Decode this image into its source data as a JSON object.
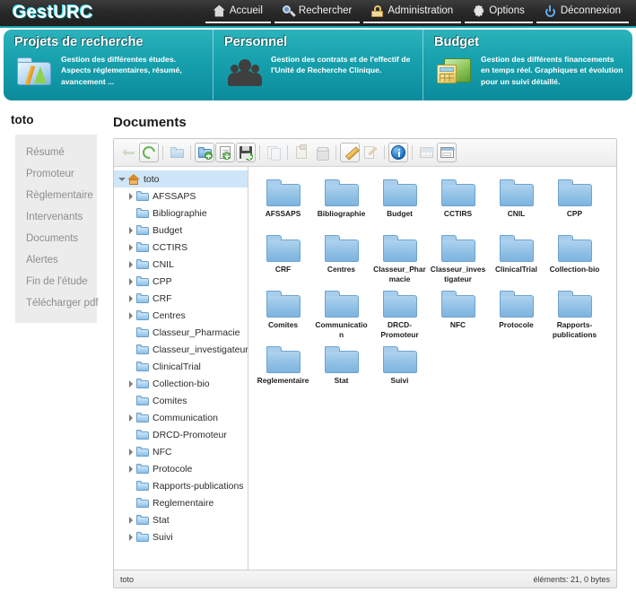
{
  "app": {
    "logo": "GestURC"
  },
  "mainnav": [
    {
      "label": "Accueil",
      "icon": "home-icon"
    },
    {
      "label": "Rechercher",
      "icon": "search-icon"
    },
    {
      "label": "Administration",
      "icon": "lock-icon"
    },
    {
      "label": "Options",
      "icon": "gear-icon"
    },
    {
      "label": "Déconnexion",
      "icon": "power-icon"
    }
  ],
  "banner": {
    "cards": [
      {
        "title": "Projets de recherche",
        "desc": "Gestion des différentes études. Aspects réglementaires, résumé, avancement ...",
        "icon": "folder-ruler-icon"
      },
      {
        "title": "Personnel",
        "desc": "Gestion des contrats et de l'effectif de l'Unité de Recherche Clinique.",
        "icon": "people-icon"
      },
      {
        "title": "Budget",
        "desc": "Gestion des différents financements en temps réel. Graphiques et évolution pour un suivi détaillé.",
        "icon": "calculator-folder-icon"
      }
    ]
  },
  "sidebar": {
    "study_title": "toto",
    "items": [
      {
        "label": "Résumé"
      },
      {
        "label": "Promoteur"
      },
      {
        "label": "Règlementaire"
      },
      {
        "label": "Intervenants"
      },
      {
        "label": "Documents"
      },
      {
        "label": "Alertes"
      },
      {
        "label": "Fin de l'étude"
      },
      {
        "label": "Télécharger pdf"
      }
    ]
  },
  "main": {
    "title": "Documents"
  },
  "toolbar": {
    "buttons": [
      {
        "name": "back-button",
        "icon": "back-arrow-icon",
        "glyph": "g-arrow",
        "state": "dim",
        "framed": false,
        "badge": false
      },
      {
        "name": "refresh-button",
        "icon": "refresh-icon",
        "glyph": "g-refresh",
        "state": "normal",
        "framed": true,
        "badge": false
      },
      {
        "sep": true
      },
      {
        "name": "folder-button",
        "icon": "folder-icon",
        "glyph": "g-fold",
        "state": "dim",
        "framed": false,
        "badge": false
      },
      {
        "sep": true
      },
      {
        "name": "new-folder-button",
        "icon": "folder-add-icon",
        "glyph": "g-fold",
        "state": "normal",
        "framed": true,
        "badge": true
      },
      {
        "name": "new-file-button",
        "icon": "file-add-icon",
        "glyph": "g-page",
        "state": "normal",
        "framed": true,
        "badge": true
      },
      {
        "name": "save-button",
        "icon": "floppy-add-icon",
        "glyph": "g-disk",
        "state": "normal",
        "framed": true,
        "badge": true
      },
      {
        "sep": true
      },
      {
        "name": "copy-button",
        "icon": "copy-icon",
        "glyph": "g-copy",
        "state": "dim",
        "framed": false,
        "badge": false
      },
      {
        "sep": true
      },
      {
        "name": "paste-button",
        "icon": "clipboard-icon",
        "glyph": "g-clip",
        "state": "dim",
        "framed": false,
        "badge": false
      },
      {
        "name": "delete-button",
        "icon": "trash-icon",
        "glyph": "g-bin",
        "state": "dim",
        "framed": false,
        "badge": false
      },
      {
        "sep": true
      },
      {
        "name": "rename-button",
        "icon": "pencil-icon",
        "glyph": "g-pencil",
        "state": "normal",
        "framed": true,
        "badge": false
      },
      {
        "name": "edit-button",
        "icon": "edit-document-icon",
        "glyph": "g-edit",
        "state": "dim",
        "framed": false,
        "badge": false
      },
      {
        "sep": true
      },
      {
        "name": "info-button",
        "icon": "info-icon",
        "glyph": "g-info",
        "state": "normal",
        "framed": true,
        "badge": false
      },
      {
        "sep": true
      },
      {
        "name": "list-view-button",
        "icon": "grid-view-icon",
        "glyph": "g-grid",
        "state": "dim",
        "framed": false,
        "badge": false
      },
      {
        "name": "icon-view-button",
        "icon": "pane-view-icon",
        "glyph": "g-pane",
        "state": "normal",
        "framed": true,
        "badge": false
      }
    ]
  },
  "tree": {
    "root": {
      "label": "toto",
      "icon": "home-icon",
      "expanded": true,
      "selected": true
    },
    "nodes": [
      {
        "label": "AFSSAPS",
        "expandable": true
      },
      {
        "label": "Bibliographie",
        "expandable": false
      },
      {
        "label": "Budget",
        "expandable": true
      },
      {
        "label": "CCTIRS",
        "expandable": true
      },
      {
        "label": "CNIL",
        "expandable": true
      },
      {
        "label": "CPP",
        "expandable": true
      },
      {
        "label": "CRF",
        "expandable": true
      },
      {
        "label": "Centres",
        "expandable": true
      },
      {
        "label": "Classeur_Pharmacie",
        "expandable": false
      },
      {
        "label": "Classeur_investigateur",
        "expandable": false
      },
      {
        "label": "ClinicalTrial",
        "expandable": false
      },
      {
        "label": "Collection-bio",
        "expandable": true
      },
      {
        "label": "Comites",
        "expandable": false
      },
      {
        "label": "Communication",
        "expandable": true
      },
      {
        "label": "DRCD-Promoteur",
        "expandable": false
      },
      {
        "label": "NFC",
        "expandable": true
      },
      {
        "label": "Protocole",
        "expandable": true
      },
      {
        "label": "Rapports-publications",
        "expandable": false
      },
      {
        "label": "Reglementaire",
        "expandable": false
      },
      {
        "label": "Stat",
        "expandable": true
      },
      {
        "label": "Suivi",
        "expandable": true
      }
    ]
  },
  "grid": {
    "items": [
      {
        "label": "AFSSAPS"
      },
      {
        "label": "Bibliographie"
      },
      {
        "label": "Budget"
      },
      {
        "label": "CCTIRS"
      },
      {
        "label": "CNIL"
      },
      {
        "label": "CPP"
      },
      {
        "label": "CRF"
      },
      {
        "label": "Centres"
      },
      {
        "label": "Classeur_Pharmacie"
      },
      {
        "label": "Classeur_investigateur"
      },
      {
        "label": "ClinicalTrial"
      },
      {
        "label": "Collection-bio"
      },
      {
        "label": "Comites"
      },
      {
        "label": "Communication"
      },
      {
        "label": "DRCD-Promoteur"
      },
      {
        "label": "NFC"
      },
      {
        "label": "Protocole"
      },
      {
        "label": "Rapports-publications"
      },
      {
        "label": "Reglementaire"
      },
      {
        "label": "Stat"
      },
      {
        "label": "Suivi"
      }
    ]
  },
  "statusbar": {
    "path": "toto",
    "info": "éléments: 21, 0 bytes"
  },
  "colors": {
    "accent_teal": "#18a2ae",
    "topbar_black": "#262626",
    "selection_blue": "#cfe5f8",
    "folder_blue": "#93c2e6",
    "sidebar_grey": "#ececec"
  }
}
